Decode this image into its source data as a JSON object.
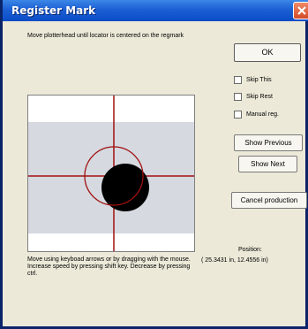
{
  "window": {
    "title": "Register Mark"
  },
  "instruction": "Move plotterhead until locator is centered on the regmark",
  "buttons": {
    "ok": "OK",
    "show_previous": "Show Previous",
    "show_next": "Show Next",
    "cancel_production": "Cancel production"
  },
  "checkboxes": [
    {
      "label": "Skip This",
      "checked": false
    },
    {
      "label": "Skip Rest",
      "checked": false
    },
    {
      "label": "Manual reg.",
      "checked": false
    }
  ],
  "help_text": "Move using keyboad arrows or by dragging with the mouse. Increase speed by pressing shift key. Decrease by pressing ctrl.",
  "position": {
    "label": "Position:",
    "value": "( 25.3431 in, 12.4556 in)"
  },
  "colors": {
    "crosshair": "#a01010",
    "registration_mark": "#000000",
    "surface": "#d6d9e0",
    "title_bar": "#1c5fd4",
    "close_button": "#d24b2a"
  }
}
